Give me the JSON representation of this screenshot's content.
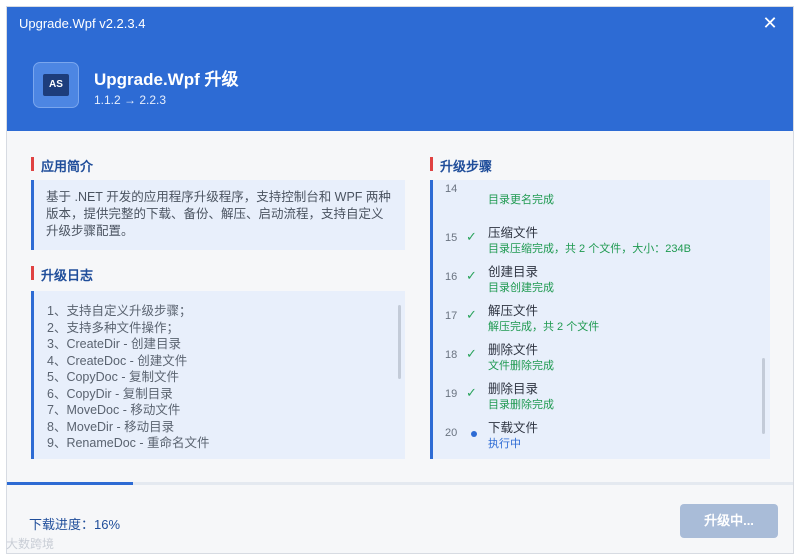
{
  "window": {
    "title": "Upgrade.Wpf v2.2.3.4",
    "close_glyph": "✕"
  },
  "header": {
    "logo_text": "AS",
    "app_name": "Upgrade.Wpf 升级",
    "version_line": "1.1.2 → 2.2.3"
  },
  "intro": {
    "title": "应用简介",
    "text": "基于 .NET 开发的应用程序升级程序，支持控制台和 WPF 两种版本，提供完整的下载、备份、解压、启动流程，支持自定义升级步骤配置。"
  },
  "log": {
    "title": "升级日志",
    "items": [
      "1、支持自定义升级步骤；",
      "2、支持多种文件操作；",
      "3、CreateDir - 创建目录",
      "4、CreateDoc - 创建文件",
      "5、CopyDoc - 复制文件",
      "6、CopyDir - 复制目录",
      "7、MoveDoc - 移动文件",
      "8、MoveDir - 移动目录",
      "9、RenameDoc - 重命名文件"
    ]
  },
  "steps": {
    "title": "升级步骤",
    "items": [
      {
        "num": "14",
        "name": "",
        "sub": "目录更名完成",
        "status": "done"
      },
      {
        "num": "15",
        "name": "压缩文件",
        "sub": "目录压缩完成，共 2 个文件，大小：234B",
        "status": "done"
      },
      {
        "num": "16",
        "name": "创建目录",
        "sub": "目录创建完成",
        "status": "done"
      },
      {
        "num": "17",
        "name": "解压文件",
        "sub": "解压完成，共 2 个文件",
        "status": "done"
      },
      {
        "num": "18",
        "name": "删除文件",
        "sub": "文件删除完成",
        "status": "done"
      },
      {
        "num": "19",
        "name": "删除目录",
        "sub": "目录删除完成",
        "status": "done"
      },
      {
        "num": "20",
        "name": "下载文件",
        "sub": "执行中",
        "status": "running"
      }
    ],
    "check_glyph": "✓"
  },
  "footer": {
    "progress_label": "下载进度：16%",
    "progress_value": 0.16,
    "button_label": "升级中..."
  },
  "watermark": "大数跨境",
  "colors": {
    "accent": "#2d6bd4",
    "success": "#1f9a51",
    "section_mark": "#e04242",
    "button_disabled": "#a9bcd8"
  }
}
